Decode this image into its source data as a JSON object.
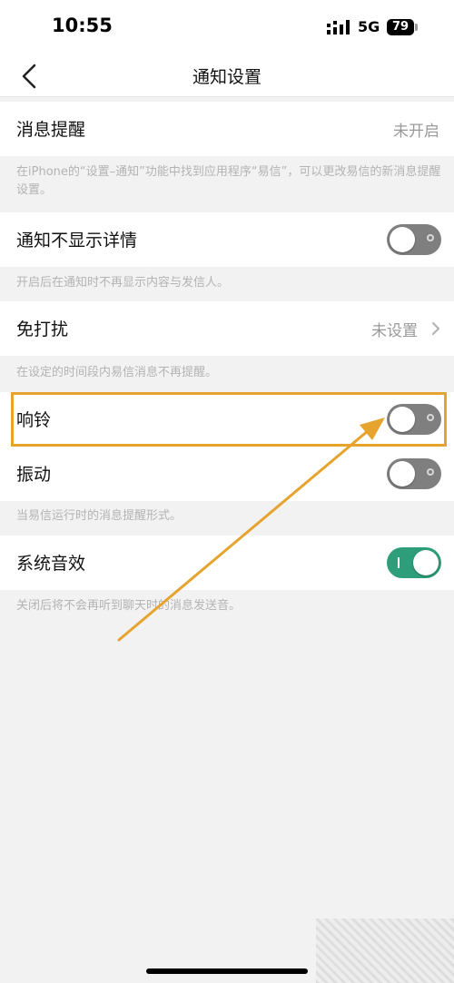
{
  "status_bar": {
    "time": "10:55",
    "network": "5G",
    "battery": "79"
  },
  "nav": {
    "title": "通知设置"
  },
  "rows": {
    "message_alert": {
      "label": "消息提醒",
      "value": "未开启"
    },
    "message_alert_note": "在iPhone的“设置–通知”功能中找到应用程序“易信”，可以更改易信的新消息提醒设置。",
    "hide_details": {
      "label": "通知不显示详情",
      "enabled": false
    },
    "hide_details_note": "开启后在通知时不再显示内容与发信人。",
    "do_not_disturb": {
      "label": "免打扰",
      "value": "未设置"
    },
    "do_not_disturb_note": "在设定的时间段内易信消息不再提醒。",
    "ringtone": {
      "label": "响铃",
      "enabled": false
    },
    "vibrate": {
      "label": "振动",
      "enabled": false
    },
    "alert_style_note": "当易信运行时的消息提醒形式。",
    "system_sound": {
      "label": "系统音效",
      "enabled": true
    },
    "system_sound_note": "关闭后将不会再听到聊天时的消息发送音。"
  },
  "colors": {
    "accent_green": "#2e9e7a",
    "highlight_orange": "#e6a32e",
    "toggle_off": "#7f7f7f"
  }
}
